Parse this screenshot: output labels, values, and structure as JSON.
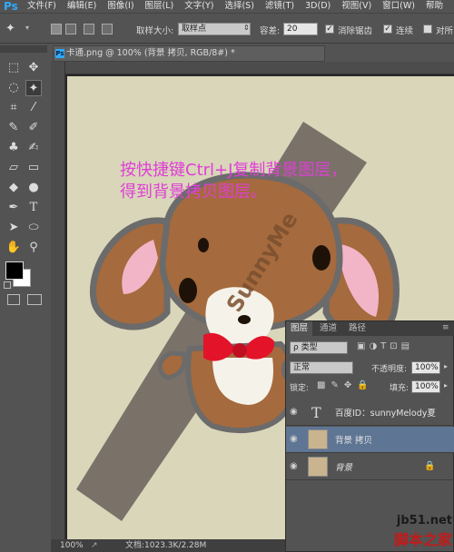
{
  "app": {
    "logo": "Ps"
  },
  "menu": {
    "items": [
      "文件(F)",
      "编辑(E)",
      "图像(I)",
      "图层(L)",
      "文字(Y)",
      "选择(S)",
      "滤镜(T)",
      "3D(D)",
      "视图(V)",
      "窗口(W)",
      "帮助"
    ]
  },
  "options": {
    "sample_size_label": "取样大小:",
    "sample_size_value": "取样点",
    "tolerance_label": "容差:",
    "tolerance_value": "20",
    "anti_alias_label": "消除锯齿",
    "contiguous_label": "连续",
    "all_layers_label": "对所"
  },
  "document": {
    "tab_title": "卡通.png @ 100% (背景 拷贝, RGB/8#) *"
  },
  "instruction": {
    "line1": "按快捷键Ctrl+J复制背景图层，",
    "line2": "得到背景拷贝图层。"
  },
  "watermark": {
    "text": "SunnyMe"
  },
  "status": {
    "zoom": "100%",
    "doc_info": "文档:1023.3K/2.28M"
  },
  "layers_panel": {
    "tabs": [
      "图层",
      "通道",
      "路径"
    ],
    "filter_value": "类型",
    "blend_mode": "正常",
    "opacity_label": "不透明度:",
    "opacity_value": "100%",
    "lock_label": "锁定:",
    "fill_label": "填充:",
    "fill_value": "100%",
    "layers": [
      {
        "name": "百度ID：sunnyMelody夏",
        "type": "text",
        "selected": false
      },
      {
        "name": "背景 拷贝",
        "type": "image",
        "selected": true
      },
      {
        "name": "背景",
        "type": "image",
        "selected": false,
        "locked": true
      }
    ]
  },
  "site_watermark": {
    "line1": "jb51.net",
    "line2": "脚本之家"
  },
  "colors": {
    "selected_layer": "#5e7594",
    "instruction_text": "#e03ed6",
    "canvas_bg": "#d9d6ba"
  }
}
